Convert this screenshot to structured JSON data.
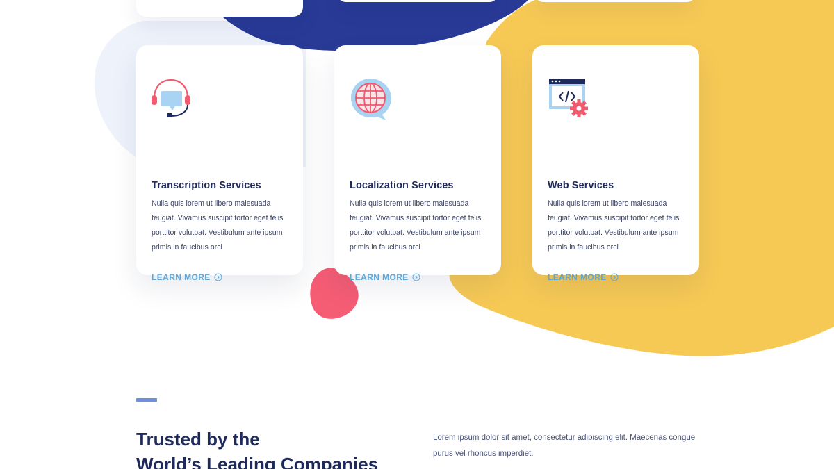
{
  "colors": {
    "navy_blob": "#283a96",
    "yellow_blob": "#f6c955",
    "pale_blob": "#eef2fb",
    "pink_blob": "#f55d75",
    "heading": "#1e2a5c",
    "link": "#5aa7dc",
    "accent_bar": "#6d8fe0"
  },
  "services": [
    {
      "icon": "headset-chat-icon",
      "title": "Transcription Services",
      "description": "Nulla quis lorem ut libero malesuada feugiat. Vivamus suscipit tortor eget felis porttitor volutpat. Vestibulum ante ipsum primis in faucibus orci",
      "link_label": "LEARN MORE"
    },
    {
      "icon": "globe-chat-icon",
      "title": "Localization Services",
      "description": "Nulla quis lorem ut libero malesuada feugiat. Vivamus suscipit tortor eget felis porttitor volutpat. Vestibulum ante ipsum primis in faucibus orci",
      "link_label": "LEARN MORE"
    },
    {
      "icon": "code-window-gear-icon",
      "title": "Web Services",
      "description": "Nulla quis lorem ut libero malesuada feugiat. Vivamus suscipit tortor eget felis porttitor volutpat. Vestibulum ante ipsum primis in faucibus orci",
      "link_label": "LEARN MORE"
    }
  ],
  "trusted": {
    "heading_line1": "Trusted by the",
    "heading_line2": "World’s Leading Companies",
    "text": "Lorem ipsum dolor sit amet, consectetur adipiscing elit. Maecenas congue purus vel rhoncus imperdiet."
  }
}
